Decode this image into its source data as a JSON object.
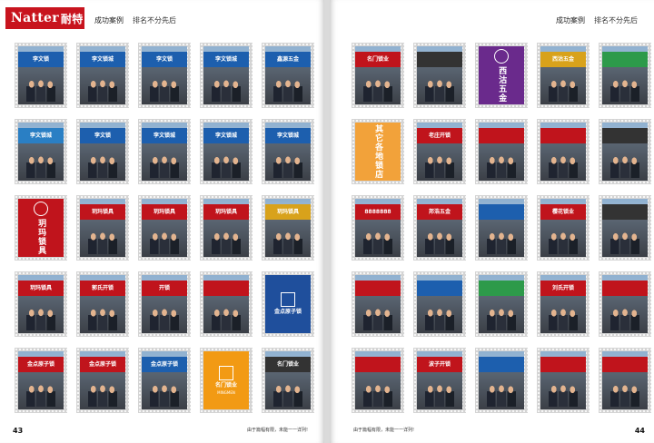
{
  "brand": {
    "name": "Natter",
    "name_cn": "耐特",
    "color": "#c8141e"
  },
  "pages": [
    {
      "side": "left",
      "header_title": "成功案例",
      "header_sub": "排名不分先后",
      "page_number": "43",
      "footer_note": "由于篇幅有限，未能一一详列!",
      "tiles": [
        {
          "kind": "photo",
          "sign": "李文锁",
          "sign_color": "#1d5fae"
        },
        {
          "kind": "photo",
          "sign": "李文锁城",
          "sign_color": "#1d5fae"
        },
        {
          "kind": "photo",
          "sign": "李文锁",
          "sign_color": "#1d5fae"
        },
        {
          "kind": "photo",
          "sign": "李文锁城",
          "sign_color": "#1d5fae"
        },
        {
          "kind": "photo",
          "sign": "鑫源五金",
          "sign_color": "#1d5fae"
        },
        {
          "kind": "photo",
          "sign": "李文锁城",
          "sign_color": "#2a7fc4"
        },
        {
          "kind": "photo",
          "sign": "李文锁",
          "sign_color": "#1d5fae"
        },
        {
          "kind": "photo",
          "sign": "李文锁城",
          "sign_color": "#1d5fae"
        },
        {
          "kind": "photo",
          "sign": "李文锁城",
          "sign_color": "#1d5fae"
        },
        {
          "kind": "photo",
          "sign": "李文锁城",
          "sign_color": "#1d5fae"
        },
        {
          "kind": "logo",
          "text": "玥玛锁具",
          "sub": "",
          "bg": "#c0141c",
          "mark": "circle"
        },
        {
          "kind": "photo",
          "sign": "玥玛锁具",
          "sign_color": "#c0141c"
        },
        {
          "kind": "photo",
          "sign": "玥玛锁具",
          "sign_color": "#c0141c"
        },
        {
          "kind": "photo",
          "sign": "玥玛锁具",
          "sign_color": "#c0141c"
        },
        {
          "kind": "photo",
          "sign": "玥玛锁具",
          "sign_color": "#d8a21b"
        },
        {
          "kind": "photo",
          "sign": "玥玛锁具",
          "sign_color": "#c0141c"
        },
        {
          "kind": "photo",
          "sign": "郭氏开锁",
          "sign_color": "#c0141c"
        },
        {
          "kind": "photo",
          "sign": "开锁",
          "sign_color": "#c0141c"
        },
        {
          "kind": "photo",
          "sign": "",
          "sign_color": "#c0141c"
        },
        {
          "kind": "logo",
          "text": "金点原子锁",
          "sub": "",
          "bg": "#1f4f9c",
          "mark": "square",
          "horizontal": true
        },
        {
          "kind": "photo",
          "sign": "金点原子锁",
          "sign_color": "#c0141c"
        },
        {
          "kind": "photo",
          "sign": "金点原子锁",
          "sign_color": "#c0141c"
        },
        {
          "kind": "photo",
          "sign": "金点原子锁",
          "sign_color": "#1d5fae"
        },
        {
          "kind": "logo",
          "text": "名门锁业",
          "sub": "MINGMEN",
          "bg": "#f29a14",
          "mark": "square",
          "horizontal": true
        },
        {
          "kind": "photo",
          "sign": "名门锁业",
          "sign_color": "#333333"
        }
      ]
    },
    {
      "side": "right",
      "header_title": "成功案例",
      "header_sub": "排名不分先后",
      "page_number": "44",
      "footer_note": "由于篇幅有限，未能一一详列!",
      "tiles": [
        {
          "kind": "photo",
          "sign": "名门锁业",
          "sign_color": "#c0141c"
        },
        {
          "kind": "photo",
          "sign": "",
          "sign_color": "#333333"
        },
        {
          "kind": "logo",
          "text": "西沽五金",
          "sub": "",
          "bg": "#6a2a8c",
          "mark": "circle"
        },
        {
          "kind": "photo",
          "sign": "西沽五金",
          "sign_color": "#d8a21b"
        },
        {
          "kind": "photo",
          "sign": "",
          "sign_color": "#2d9a4a"
        },
        {
          "kind": "logo",
          "text": "其它各地锁店",
          "sub": "",
          "bg": "#f2a23a",
          "mark": "none"
        },
        {
          "kind": "photo",
          "sign": "老庄开锁",
          "sign_color": "#c0141c"
        },
        {
          "kind": "photo",
          "sign": "",
          "sign_color": "#c0141c"
        },
        {
          "kind": "photo",
          "sign": "",
          "sign_color": "#c0141c"
        },
        {
          "kind": "photo",
          "sign": "",
          "sign_color": "#333333"
        },
        {
          "kind": "photo",
          "sign": "8888888",
          "sign_color": "#c0141c"
        },
        {
          "kind": "photo",
          "sign": "邦浩五金",
          "sign_color": "#c0141c"
        },
        {
          "kind": "photo",
          "sign": "",
          "sign_color": "#1d5fae"
        },
        {
          "kind": "photo",
          "sign": "樱花锁业",
          "sign_color": "#c0141c"
        },
        {
          "kind": "photo",
          "sign": "",
          "sign_color": "#333333"
        },
        {
          "kind": "photo",
          "sign": "",
          "sign_color": "#c0141c"
        },
        {
          "kind": "photo",
          "sign": "",
          "sign_color": "#1d5fae"
        },
        {
          "kind": "photo",
          "sign": "",
          "sign_color": "#2d9a4a"
        },
        {
          "kind": "photo",
          "sign": "刘氏开锁",
          "sign_color": "#c0141c"
        },
        {
          "kind": "photo",
          "sign": "",
          "sign_color": "#c0141c"
        },
        {
          "kind": "photo",
          "sign": "",
          "sign_color": "#c0141c"
        },
        {
          "kind": "photo",
          "sign": "波子开锁",
          "sign_color": "#c0141c"
        },
        {
          "kind": "photo",
          "sign": "",
          "sign_color": "#1d5fae"
        },
        {
          "kind": "photo",
          "sign": "",
          "sign_color": "#c0141c"
        },
        {
          "kind": "photo",
          "sign": "",
          "sign_color": "#c0141c"
        }
      ]
    }
  ]
}
